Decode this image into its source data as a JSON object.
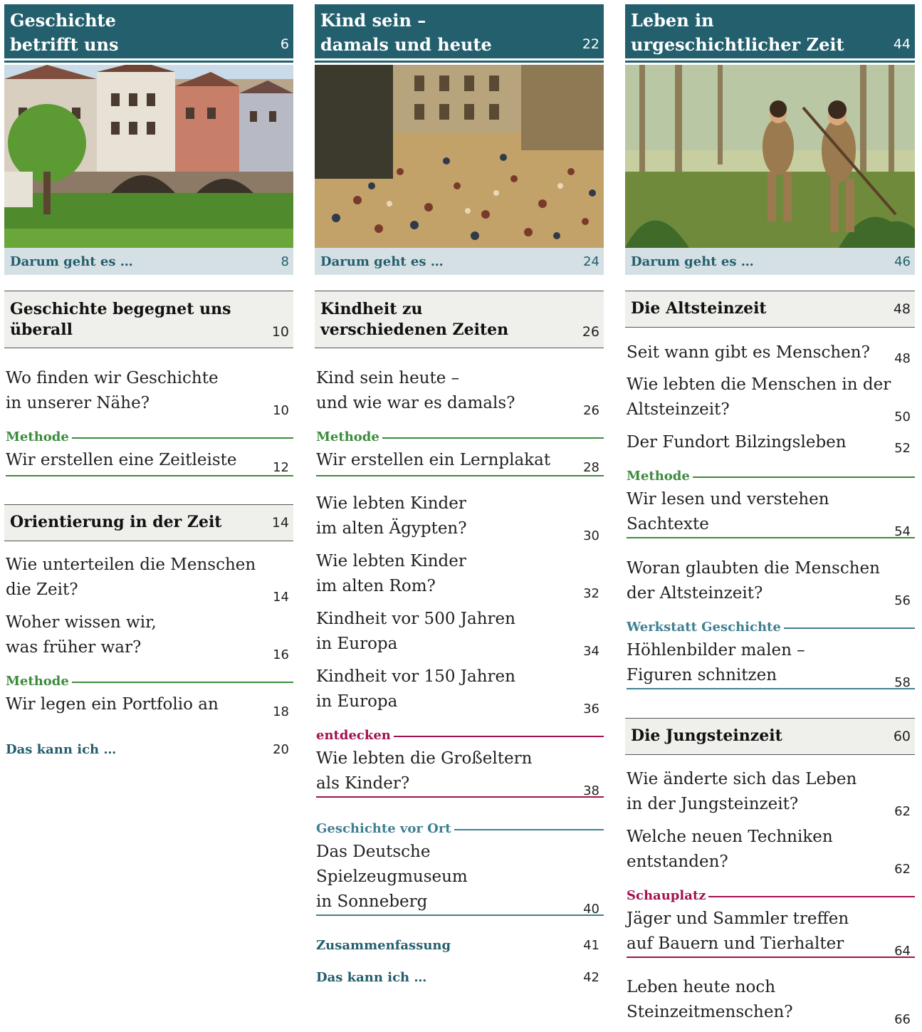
{
  "col1": {
    "chapter": {
      "title_l1": "Geschichte",
      "title_l2": "betrifft uns",
      "page": "6"
    },
    "darum": {
      "label": "Darum geht es …",
      "page": "8"
    },
    "section1": {
      "title_l1": "Geschichte begegnet uns",
      "title_l2": "überall",
      "page": "10"
    },
    "e1": {
      "l1": "Wo finden wir Geschichte",
      "l2": "in unserer Nähe?",
      "page": "10"
    },
    "methode1": {
      "tag": "Methode",
      "text": "Wir erstellen eine Zeitleiste",
      "page": "12"
    },
    "section2": {
      "title": "Orientierung in der Zeit",
      "page": "14"
    },
    "e2": {
      "l1": "Wie unterteilen die Menschen",
      "l2": "die Zeit?",
      "page": "14"
    },
    "e3": {
      "l1": "Woher wissen wir,",
      "l2": "was früher war?",
      "page": "16"
    },
    "methode2": {
      "tag": "Methode",
      "text": "Wir legen ein Portfolio an",
      "page": "18"
    },
    "kann": {
      "label": "Das kann ich …",
      "page": "20"
    }
  },
  "col2": {
    "chapter": {
      "title_l1": "Kind sein –",
      "title_l2": "damals und heute",
      "page": "22"
    },
    "darum": {
      "label": "Darum geht es …",
      "page": "24"
    },
    "section1": {
      "title_l1": "Kindheit zu",
      "title_l2": "verschiedenen Zeiten",
      "page": "26"
    },
    "e1": {
      "l1": "Kind sein heute –",
      "l2": "und wie war es damals?",
      "page": "26"
    },
    "methode1": {
      "tag": "Methode",
      "text": "Wir erstellen ein Lernplakat",
      "page": "28"
    },
    "e2": {
      "l1": "Wie lebten Kinder",
      "l2": "im alten Ägypten?",
      "page": "30"
    },
    "e3": {
      "l1": "Wie lebten Kinder",
      "l2": "im alten Rom?",
      "page": "32"
    },
    "e4": {
      "l1": "Kindheit vor 500 Jahren",
      "l2": "in Europa",
      "page": "34"
    },
    "e5": {
      "l1": "Kindheit vor 150 Jahren",
      "l2": "in Europa",
      "page": "36"
    },
    "entdecken": {
      "tag": "entdecken",
      "l1": "Wie lebten die Großeltern",
      "l2": "als Kinder?",
      "page": "38"
    },
    "vorort": {
      "tag": "Geschichte vor Ort",
      "l1": "Das Deutsche",
      "l2": "Spielzeugmuseum",
      "l3": "in Sonneberg",
      "page": "40"
    },
    "zus": {
      "label": "Zusammenfassung",
      "page": "41"
    },
    "kann": {
      "label": "Das kann ich …",
      "page": "42"
    }
  },
  "col3": {
    "chapter": {
      "title_l1": "Leben in",
      "title_l2": "urgeschichtlicher Zeit",
      "page": "44"
    },
    "darum": {
      "label": "Darum geht es …",
      "page": "46"
    },
    "section1": {
      "title": "Die Altsteinzeit",
      "page": "48"
    },
    "e1": {
      "l1": "Seit wann gibt es Menschen?",
      "page": "48"
    },
    "e2": {
      "l1": "Wie lebten die Menschen in der",
      "l2": "Altsteinzeit?",
      "page": "50"
    },
    "e3": {
      "l1": "Der Fundort Bilzingsleben",
      "page": "52"
    },
    "methode1": {
      "tag": "Methode",
      "l1": "Wir lesen und verstehen",
      "l2": "Sachtexte",
      "page": "54"
    },
    "e4": {
      "l1": "Woran glaubten die Menschen",
      "l2": "der Altsteinzeit?",
      "page": "56"
    },
    "werkstatt": {
      "tag": "Werkstatt Geschichte",
      "l1": "Höhlenbilder malen –",
      "l2": "Figuren schnitzen",
      "page": "58"
    },
    "section2": {
      "title": "Die Jungsteinzeit",
      "page": "60"
    },
    "e5": {
      "l1": "Wie änderte sich das Leben",
      "l2": "in der Jungsteinzeit?",
      "page": "62"
    },
    "e6": {
      "l1": "Welche neuen Techniken",
      "l2": "entstanden?",
      "page": "62"
    },
    "schauplatz": {
      "tag": "Schauplatz",
      "l1": "Jäger und Sammler treffen",
      "l2": "auf Bauern und Tierhalter",
      "page": "64"
    },
    "e7": {
      "l1": "Leben heute noch",
      "l2": "Steinzeitmenschen?",
      "page": "66"
    }
  }
}
